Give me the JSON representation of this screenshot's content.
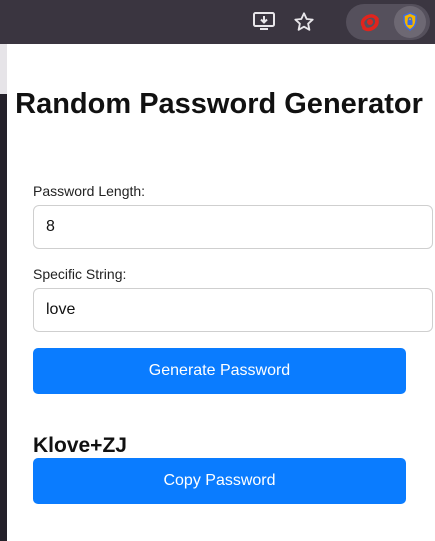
{
  "browser": {
    "icons": [
      "install-app-icon",
      "bookmark-star-icon",
      "red-extension-icon",
      "password-extension-icon"
    ]
  },
  "popup": {
    "title": "Random Password Generator",
    "length_label": "Password Length:",
    "length_value": "8",
    "string_label": "Specific String:",
    "string_value": "love",
    "generate_label": "Generate Password",
    "result": "Klove+ZJ",
    "copy_label": "Copy Password"
  },
  "colors": {
    "accent": "#0a7cff",
    "toolbar": "#3b3641"
  }
}
